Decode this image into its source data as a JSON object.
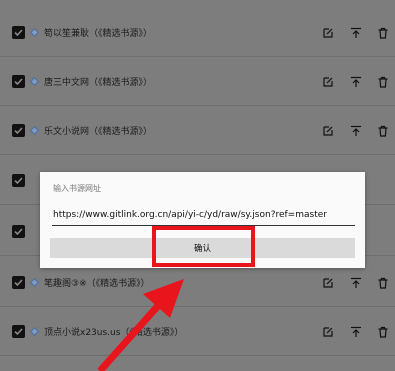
{
  "rows": [
    {
      "title": "笱以笙兼耿（《精选书源》）"
    },
    {
      "title": "唐三中文网（《精选书源》）"
    },
    {
      "title": "乐文小说网（《精选书源》）"
    },
    {
      "title": ""
    },
    {
      "title": ""
    },
    {
      "title": "笔趣阁③※（《精选书源》）"
    },
    {
      "title": "顶点小说x23us.us（《精选书源》）"
    }
  ],
  "icons": {
    "check": "checkbox-checked-icon",
    "source": "source-diamond-icon",
    "edit": "edit-icon",
    "top": "move-to-top-icon",
    "delete": "delete-icon"
  },
  "dialog": {
    "label": "输入书源网址",
    "input_value": "https://www.gitlink.org.cn/api/yi-c/yd/raw/sy.json?ref=master",
    "confirm_label": "确认"
  },
  "colors": {
    "highlight": "#e8151c",
    "diamond": "#5b7fb8",
    "dim_background": "#7d7d7d"
  }
}
